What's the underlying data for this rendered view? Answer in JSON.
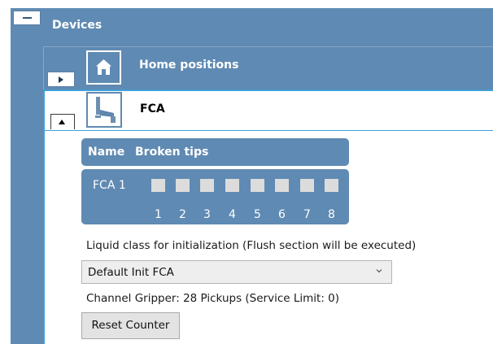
{
  "devices": {
    "title": "Devices"
  },
  "home": {
    "label": "Home positions"
  },
  "fca": {
    "label": "FCA",
    "table": {
      "headers": [
        "Name",
        "Broken tips"
      ],
      "rows": [
        {
          "name": "FCA 1",
          "tips": [
            false,
            false,
            false,
            false,
            false,
            false,
            false,
            false
          ]
        }
      ],
      "channels": [
        "1",
        "2",
        "3",
        "4",
        "5",
        "6",
        "7",
        "8"
      ]
    },
    "liquid_class_label": "Liquid class for initialization (Flush section will be executed)",
    "liquid_class_value": "Default Init FCA",
    "gripper_text": "Channel Gripper: 28 Pickups (Service Limit: 0)",
    "reset_button": "Reset Counter"
  },
  "colors": {
    "panel": "#5f8ab3",
    "accent": "#3fa0d8",
    "tip": "#dcdcdc"
  }
}
